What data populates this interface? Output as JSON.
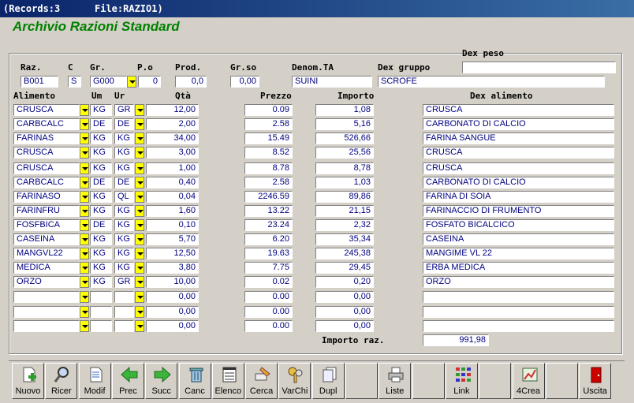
{
  "titlebar": {
    "records": "(Records:3",
    "file": "File:RAZIO1)"
  },
  "app_title": "Archivio Razioni Standard",
  "header": {
    "labels": {
      "raz": "Raz.",
      "c": "C",
      "gr": "Gr.",
      "po": "P.o",
      "prod": "Prod.",
      "grso": "Gr.so",
      "denom": "Denom.TA",
      "dexgruppo": "Dex gruppo",
      "dexpeso": "Dex peso"
    },
    "values": {
      "raz": "B001",
      "c": "S",
      "gr": "G000",
      "po": "0",
      "prod": "0,0",
      "grso": "0,00",
      "denom": "SUINI",
      "dexgruppo": "SCROFE",
      "dexpeso": ""
    }
  },
  "columns": {
    "alimento": "Alimento",
    "um": "Um",
    "ur": "Ur",
    "qta": "Qtà",
    "prezzo": "Prezzo",
    "importo": "Importo",
    "dex": "Dex alimento"
  },
  "rows": [
    {
      "alimento": "CRUSCA",
      "um": "KG",
      "ur": "GR",
      "qta": "12,00",
      "prezzo": "0.09",
      "importo": "1,08",
      "dex": "CRUSCA"
    },
    {
      "alimento": "CARBCALC",
      "um": "DE",
      "ur": "DE",
      "qta": "2,00",
      "prezzo": "2.58",
      "importo": "5,16",
      "dex": "CARBONATO DI CALCIO"
    },
    {
      "alimento": "FARINAS",
      "um": "KG",
      "ur": "KG",
      "qta": "34,00",
      "prezzo": "15.49",
      "importo": "526,66",
      "dex": "FARINA SANGUE"
    },
    {
      "alimento": "CRUSCA",
      "um": "KG",
      "ur": "KG",
      "qta": "3,00",
      "prezzo": "8.52",
      "importo": "25,56",
      "dex": "CRUSCA"
    },
    {
      "alimento": "CRUSCA",
      "um": "KG",
      "ur": "KG",
      "qta": "1,00",
      "prezzo": "8.78",
      "importo": "8,78",
      "dex": "CRUSCA"
    },
    {
      "alimento": "CARBCALC",
      "um": "DE",
      "ur": "DE",
      "qta": "0,40",
      "prezzo": "2.58",
      "importo": "1,03",
      "dex": "CARBONATO DI CALCIO"
    },
    {
      "alimento": "FARINASO",
      "um": "KG",
      "ur": "QL",
      "qta": "0,04",
      "prezzo": "2246.59",
      "importo": "89,86",
      "dex": "FARINA DI SOIA"
    },
    {
      "alimento": "FARINFRU",
      "um": "KG",
      "ur": "KG",
      "qta": "1,60",
      "prezzo": "13.22",
      "importo": "21,15",
      "dex": "FARINACCIO DI FRUMENTO"
    },
    {
      "alimento": "FOSFBICA",
      "um": "DE",
      "ur": "KG",
      "qta": "0,10",
      "prezzo": "23.24",
      "importo": "2,32",
      "dex": "FOSFATO BICALCICO"
    },
    {
      "alimento": "CASEINA",
      "um": "KG",
      "ur": "KG",
      "qta": "5,70",
      "prezzo": "6.20",
      "importo": "35,34",
      "dex": "CASEINA"
    },
    {
      "alimento": "MANGVL22",
      "um": "KG",
      "ur": "KG",
      "qta": "12,50",
      "prezzo": "19.63",
      "importo": "245,38",
      "dex": "MANGIME VL 22"
    },
    {
      "alimento": "MEDICA",
      "um": "KG",
      "ur": "KG",
      "qta": "3,80",
      "prezzo": "7.75",
      "importo": "29,45",
      "dex": "ERBA MEDICA"
    },
    {
      "alimento": "ORZO",
      "um": "KG",
      "ur": "GR",
      "qta": "10,00",
      "prezzo": "0.02",
      "importo": "0,20",
      "dex": "ORZO"
    },
    {
      "alimento": "",
      "um": "",
      "ur": "",
      "qta": "0,00",
      "prezzo": "0.00",
      "importo": "0,00",
      "dex": ""
    },
    {
      "alimento": "",
      "um": "",
      "ur": "",
      "qta": "0,00",
      "prezzo": "0.00",
      "importo": "0,00",
      "dex": ""
    },
    {
      "alimento": "",
      "um": "",
      "ur": "",
      "qta": "0,00",
      "prezzo": "0.00",
      "importo": "0,00",
      "dex": ""
    }
  ],
  "total": {
    "label": "Importo raz.",
    "value": "991,98"
  },
  "toolbar": [
    {
      "label": "Nuovo",
      "icon": "new-document-icon"
    },
    {
      "label": "Ricer",
      "icon": "magnifier-icon"
    },
    {
      "label": "Modif",
      "icon": "edit-document-icon"
    },
    {
      "label": "Prec",
      "icon": "arrow-left-icon"
    },
    {
      "label": "Succ",
      "icon": "arrow-right-icon"
    },
    {
      "label": "Canc",
      "icon": "trash-icon"
    },
    {
      "label": "Elenco",
      "icon": "list-icon"
    },
    {
      "label": "Cerca",
      "icon": "search-brush-icon"
    },
    {
      "label": "VarChi",
      "icon": "keys-icon"
    },
    {
      "label": "Dupl",
      "icon": "duplicate-icon"
    },
    {
      "label": "",
      "icon": ""
    },
    {
      "label": "Liste",
      "icon": "printer-icon"
    },
    {
      "label": "",
      "icon": ""
    },
    {
      "label": "Link",
      "icon": "link-icon"
    },
    {
      "label": "",
      "icon": ""
    },
    {
      "label": "4Crea",
      "icon": "create-icon"
    },
    {
      "label": "",
      "icon": ""
    },
    {
      "label": "Uscita",
      "icon": "exit-door-icon"
    }
  ]
}
